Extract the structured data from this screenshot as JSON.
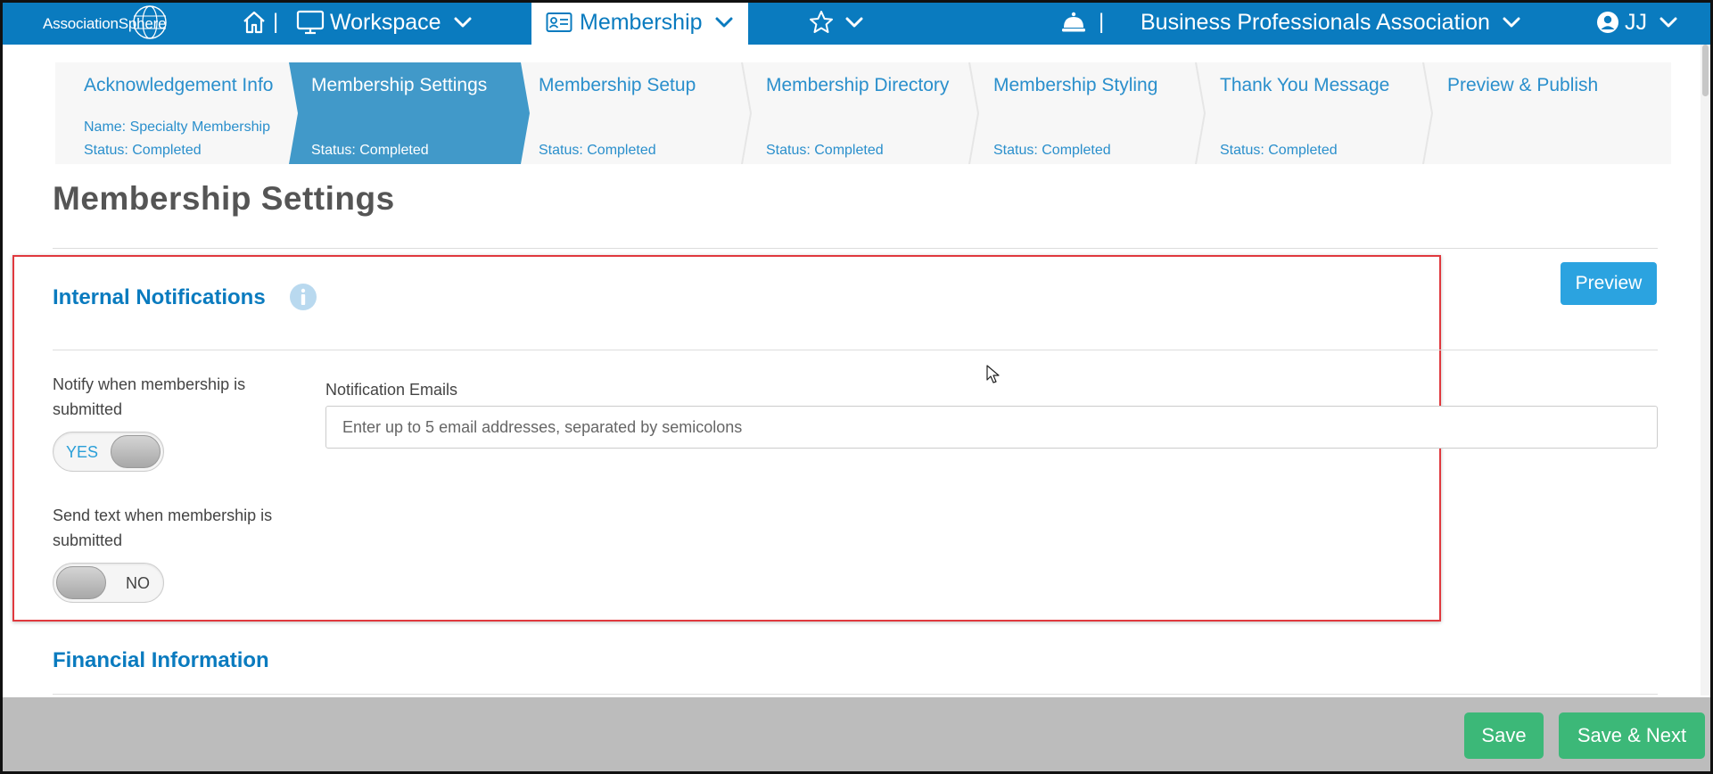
{
  "topbar": {
    "logo_text": "AssociationSphere",
    "workspace_label": "Workspace",
    "membership_label": "Membership",
    "separator": "|",
    "org_name": "Business Professionals Association",
    "user_initials": "JJ"
  },
  "wizard": {
    "steps": [
      {
        "title": "Acknowledgement Info",
        "name": "Name: Specialty Membership",
        "status": "Status: Completed"
      },
      {
        "title": "Membership Settings",
        "status": "Status: Completed"
      },
      {
        "title": "Membership Setup",
        "status": "Status: Completed"
      },
      {
        "title": "Membership Directory",
        "status": "Status: Completed"
      },
      {
        "title": "Membership Styling",
        "status": "Status: Completed"
      },
      {
        "title": "Thank You Message",
        "status": "Status: Completed"
      },
      {
        "title": "Preview & Publish"
      }
    ]
  },
  "page": {
    "title": "Membership Settings",
    "preview_label": "Preview"
  },
  "internal_notifications": {
    "title": "Internal Notifications",
    "notify_label": "Notify when membership is submitted",
    "notify_toggle": "YES",
    "text_label": "Send text when membership is submitted",
    "text_toggle": "NO",
    "emails_label": "Notification Emails",
    "emails_placeholder": "Enter up to 5 email addresses, separated by semicolons",
    "emails_value": ""
  },
  "financial": {
    "title": "Financial Information"
  },
  "footer": {
    "save_label": "Save",
    "save_next_label": "Save & Next"
  },
  "colors": {
    "brand_blue": "#0a7bbf",
    "active_step": "#4199c9",
    "preview_button": "#2ba3e0",
    "save_green": "#3cb878",
    "highlight_red": "#e0393e"
  }
}
